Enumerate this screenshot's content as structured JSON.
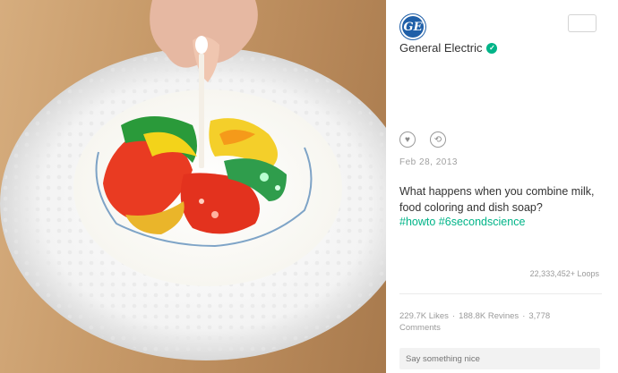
{
  "author": {
    "name": "General Electric",
    "logo_text": "GE"
  },
  "post": {
    "date": "Feb 28, 2013",
    "caption": "What happens when you combine milk, food coloring and dish soap?",
    "hashtags": [
      "#howto",
      "#6secondscience"
    ],
    "loops": "22,333,452+ Loops"
  },
  "stats": {
    "likes": "229.7K Likes",
    "revines": "188.8K Revines",
    "comments": "3,778 Comments"
  },
  "comment_input": {
    "placeholder": "Say something nice"
  },
  "icons": {
    "like": "heart-icon",
    "revine": "revine-icon",
    "verified": "verified-badge-icon"
  },
  "colors": {
    "accent": "#00b488",
    "brand": "#1f5fa8"
  }
}
